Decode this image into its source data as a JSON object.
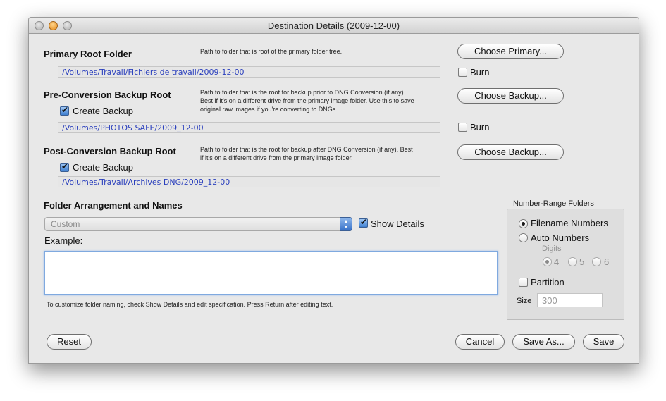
{
  "window": {
    "title": "Destination Details (2009-12-00)"
  },
  "primary": {
    "heading": "Primary Root Folder",
    "description": "Path to folder that is root of the primary folder tree.",
    "path": "/Volumes/Travail/Fichiers de travail/2009-12-00",
    "choose_label": "Choose Primary...",
    "burn_label": "Burn",
    "burn_checked": false
  },
  "pre_conversion": {
    "heading": "Pre-Conversion Backup Root",
    "description_lines": [
      "Path to folder that is the root for backup prior to DNG Conversion (if any).",
      "Best if it's on a different drive from the primary image folder. Use this to save",
      "original raw images if you're converting to DNGs."
    ],
    "create_label": "Create Backup",
    "create_checked": true,
    "path": "/Volumes/PHOTOS SAFE/2009_12-00",
    "choose_label": "Choose Backup...",
    "burn_label": "Burn",
    "burn_checked": false
  },
  "post_conversion": {
    "heading": "Post-Conversion Backup Root",
    "description_lines": [
      "Path to folder that is the root for backup after DNG Conversion (if any). Best",
      "if it's on a different drive from the primary image folder."
    ],
    "create_label": "Create Backup",
    "create_checked": true,
    "path": "/Volumes/Travail/Archives DNG/2009_12-00",
    "choose_label": "Choose Backup..."
  },
  "arrangement": {
    "heading": "Folder Arrangement and  Names",
    "selected": "Custom",
    "show_details_label": "Show Details",
    "show_details_checked": true,
    "example_label": "Example:",
    "example_value": "",
    "hint": "To customize folder naming, check Show Details and edit specification. Press Return after editing text."
  },
  "number_range": {
    "title": "Number-Range Folders",
    "filename_numbers_label": "Filename Numbers",
    "auto_numbers_label": "Auto Numbers",
    "selected_mode": "Filename Numbers",
    "digits_label": "Digits",
    "digits_options": [
      "4",
      "5",
      "6"
    ],
    "digits_selected": "4",
    "partition_label": "Partition",
    "partition_checked": false,
    "size_label": "Size",
    "size_value": "300"
  },
  "footer": {
    "reset_label": "Reset",
    "cancel_label": "Cancel",
    "save_as_label": "Save As...",
    "save_label": "Save"
  }
}
